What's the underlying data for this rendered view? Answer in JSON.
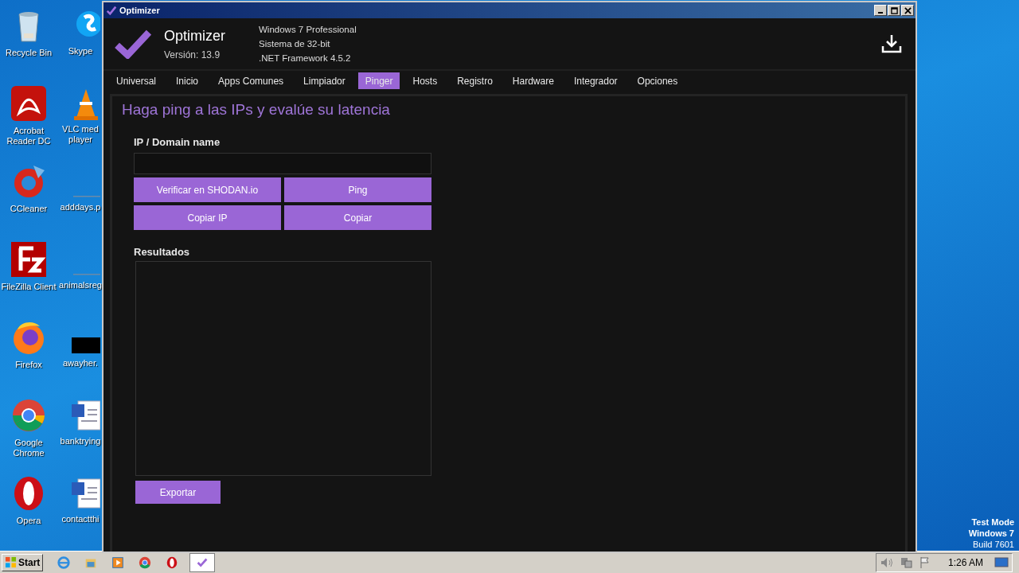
{
  "desktop": {
    "icons": [
      {
        "label": "Recycle Bin",
        "kind": "recycle"
      },
      {
        "label": "Acrobat Reader DC",
        "kind": "acrobat"
      },
      {
        "label": "CCleaner",
        "kind": "ccleaner"
      },
      {
        "label": "FileZilla Client",
        "kind": "filezilla"
      },
      {
        "label": "Firefox",
        "kind": "firefox"
      },
      {
        "label": "Google Chrome",
        "kind": "chrome"
      },
      {
        "label": "Opera",
        "kind": "opera"
      }
    ],
    "icons_column_2": [
      {
        "label": "Skype",
        "kind": "skype"
      },
      {
        "label": "VLC med player",
        "kind": "vlc"
      },
      {
        "label": "adddays.p",
        "kind": "line"
      },
      {
        "label": "animalsreg",
        "kind": "line"
      },
      {
        "label": "awayher.",
        "kind": "black"
      },
      {
        "label": "banktrying",
        "kind": "word"
      },
      {
        "label": "contactthi",
        "kind": "word"
      }
    ],
    "os_notice": [
      "Test Mode",
      "Windows 7",
      "Build 7601"
    ]
  },
  "window": {
    "title": "Optimizer"
  },
  "app": {
    "name": "Optimizer",
    "version": "Versión: 13.9",
    "system_info": [
      "Windows 7 Professional",
      "Sistema de 32-bit",
      ".NET Framework 4.5.2"
    ]
  },
  "tabs": [
    {
      "label": "Universal",
      "selected": false
    },
    {
      "label": "Inicio",
      "selected": false
    },
    {
      "label": "Apps Comunes",
      "selected": false
    },
    {
      "label": "Limpiador",
      "selected": false
    },
    {
      "label": "Pinger",
      "selected": true
    },
    {
      "label": "Hosts",
      "selected": false
    },
    {
      "label": "Registro",
      "selected": false
    },
    {
      "label": "Hardware",
      "selected": false
    },
    {
      "label": "Integrador",
      "selected": false
    },
    {
      "label": "Opciones",
      "selected": false
    }
  ],
  "pinger": {
    "heading": "Haga ping a las IPs y evalúe su latencia",
    "ip_label": "IP / Domain name",
    "buttons": [
      "Verificar en SHODAN.io",
      "Ping",
      "Copiar IP",
      "Copiar"
    ],
    "results_label": "Resultados",
    "export_button": "Exportar"
  },
  "taskbar": {
    "start": "Start",
    "apps": [
      {
        "kind": "ie",
        "selected": false
      },
      {
        "kind": "folder",
        "selected": false
      },
      {
        "kind": "media",
        "selected": false
      },
      {
        "kind": "chrome",
        "selected": false
      },
      {
        "kind": "opera",
        "selected": false
      },
      {
        "kind": "optimizer",
        "selected": true
      }
    ],
    "clock": "1:26 AM"
  }
}
